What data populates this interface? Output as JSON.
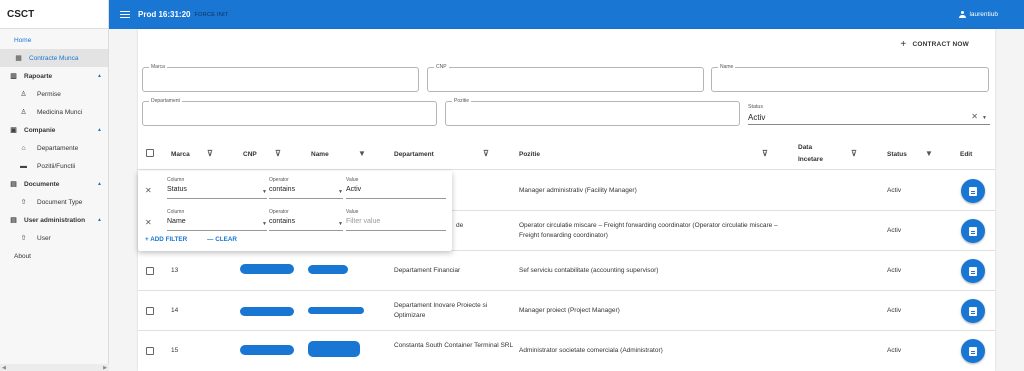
{
  "app": {
    "title": "CSCT"
  },
  "topbar": {
    "env": "Prod 16:31:20",
    "force_label": "FORCE INIT",
    "username": "laurentiub"
  },
  "sidebar": {
    "home": "Home",
    "contracte": "Contracte Munca",
    "rapoarte": "Rapoarte",
    "permise": "Permise",
    "medicina": "Medicina Munci",
    "companie": "Companie",
    "departamente": "Departamente",
    "pozitii": "Pozitii/Functii",
    "documente": "Documente",
    "document_type": "Document Type",
    "user_admin": "User administration",
    "user": "User",
    "about": "About"
  },
  "actions": {
    "add_contract": "CONTRACT NOW"
  },
  "filters": {
    "marca": "Marca",
    "cnp": "CNP",
    "name": "Name",
    "departament": "Departament",
    "pozitie": "Pozitie",
    "status_label": "Status",
    "status_value": "Activ"
  },
  "table": {
    "headers": {
      "marca": "Marca",
      "cnp": "CNP",
      "name": "Name",
      "departament": "Departament",
      "pozitie": "Pozitie",
      "data_incetare_1": "Data",
      "data_incetare_2": "Incetare",
      "status": "Status",
      "edit": "Edit"
    },
    "rows": [
      {
        "marca": "",
        "departament": "",
        "pozitie": "Manager administrativ (Facility Manager)",
        "status": "Activ"
      },
      {
        "marca": "",
        "departament": "de",
        "pozitie": "Operator circulatie miscare – Freight forwarding coordinator (Operator circulatie miscare – Freight forwarding coordinator)",
        "status": "Activ"
      },
      {
        "marca": "13",
        "departament": "Departament Financiar",
        "pozitie": "Sef serviciu contabilitate (accounting supervisor)",
        "status": "Activ"
      },
      {
        "marca": "14",
        "departament": "Departament Inovare Proiecte si Optimizare",
        "pozitie": "Manager proiect (Project Manager)",
        "status": "Activ"
      },
      {
        "marca": "15",
        "departament": "Constanta South Container Terminal SRL",
        "pozitie": "Administrator societate comerciala (Administrator)",
        "status": "Activ"
      }
    ]
  },
  "filter_panel": {
    "column_label": "Column",
    "operator_label": "Operator",
    "value_label": "Value",
    "rows": [
      {
        "column": "Status",
        "operator": "contains",
        "value": "Activ",
        "placeholder": ""
      },
      {
        "column": "Name",
        "operator": "contains",
        "value": "",
        "placeholder": "Filter value"
      }
    ],
    "add_filter": "ADD FILTER",
    "clear": "CLEAR"
  },
  "colors": {
    "primary": "#1976d2",
    "sidebar_bg": "#f7f7f7"
  },
  "icons": [
    "menu-icon",
    "account-icon",
    "home-icon",
    "chart-icon",
    "person-icon",
    "building-icon",
    "folder-icon",
    "upload-icon",
    "filter-icon",
    "close-icon",
    "document-icon",
    "plus-icon"
  ]
}
